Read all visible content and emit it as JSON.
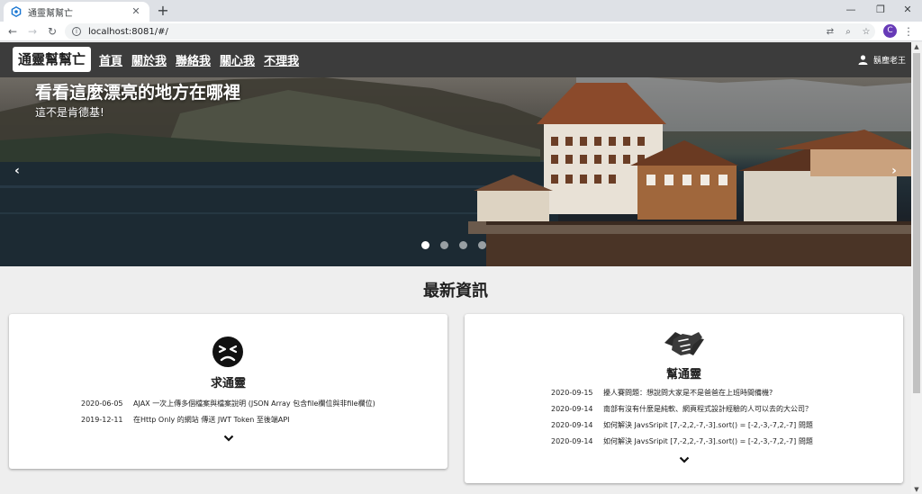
{
  "browser": {
    "tab_title": "通靈幫幫亡",
    "tab_close": "✕",
    "new_tab": "+",
    "url": "localhost:8081/#/",
    "profile_initial": "C"
  },
  "appbar": {
    "brand": "通靈幫幫亡",
    "nav": [
      "首頁",
      "關於我",
      "聯絡我",
      "關心我",
      "不理我"
    ],
    "user_name": "鬍塵老王"
  },
  "carousel": {
    "title": "看看這麼漂亮的地方在哪裡",
    "subtitle": "這不是肯德基!",
    "prev_label": "‹",
    "next_label": "›",
    "slide_count": 4,
    "active_slide": 1
  },
  "section_title": "最新資訊",
  "cards": [
    {
      "title": "求通靈",
      "icon": "sad-face-icon",
      "items": [
        {
          "date": "2020-06-05",
          "text": "AJAX 一次上傳多個檔案與檔案說明 (JSON Array 包含file欄位與非file欄位)"
        },
        {
          "date": "2019-12-11",
          "text": "在Http Only 的網站 傳送 JWT Token 至後端API"
        }
      ]
    },
    {
      "title": "幫通靈",
      "icon": "handshake-icon",
      "items": [
        {
          "date": "2020-09-15",
          "text": "擾人賽問題：想說問大家是不是爸爸在上班時間備機?"
        },
        {
          "date": "2020-09-14",
          "text": "南部有沒有什麼是純軟、網頁程式設計經驗的人可以去的大公司？"
        },
        {
          "date": "2020-09-14",
          "text": "如何解決 JavsSripit [7,-2,2,-7,-3].sort() = [-2,-3,-7,2,-7] 問題"
        },
        {
          "date": "2020-09-14",
          "text": "如何解決 JavsSripit [7,-2,2,-7,-3].sort() = [-2,-3,-7,2,-7] 問題"
        }
      ]
    }
  ],
  "colors": {
    "appbar": "#3c3c3c",
    "page_bg": "#eeeeee",
    "profile": "#673ab7"
  }
}
